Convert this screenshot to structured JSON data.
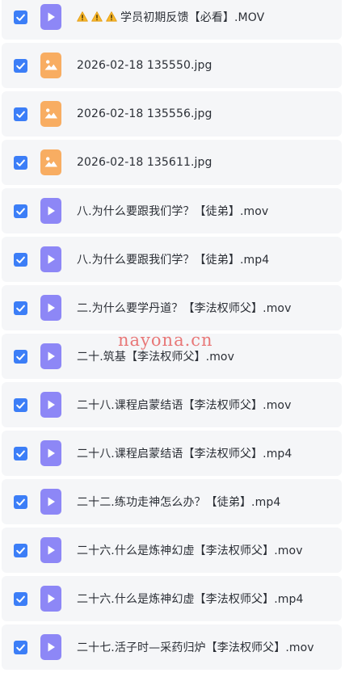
{
  "files": [
    {
      "name": "学员初期反馈【必看】.MOV",
      "type": "video",
      "checked": true,
      "prefix_icons": [
        "warning-icon",
        "warning-icon",
        "warning-icon"
      ]
    },
    {
      "name": "2026-02-18 135550.jpg",
      "type": "image",
      "checked": true
    },
    {
      "name": "2026-02-18 135556.jpg",
      "type": "image",
      "checked": true
    },
    {
      "name": "2026-02-18 135611.jpg",
      "type": "image",
      "checked": true
    },
    {
      "name": "八.为什么要跟我们学？【徒弟】.mov",
      "type": "video",
      "checked": true
    },
    {
      "name": "八.为什么要跟我们学？【徒弟】.mp4",
      "type": "video",
      "checked": true
    },
    {
      "name": "二.为什么要学丹道？【李法权师父】.mov",
      "type": "video",
      "checked": true
    },
    {
      "name": "二十.筑基【李法权师父】.mov",
      "type": "video",
      "checked": true
    },
    {
      "name": "二十八.课程启蒙结语【李法权师父】.mov",
      "type": "video",
      "checked": true
    },
    {
      "name": "二十八.课程启蒙结语【李法权师父】.mp4",
      "type": "video",
      "checked": true
    },
    {
      "name": "二十二.练功走神怎么办？【徒弟】.mp4",
      "type": "video",
      "checked": true
    },
    {
      "name": "二十六.什么是炼神幻虚【李法权师父】.mov",
      "type": "video",
      "checked": true
    },
    {
      "name": "二十六.什么是炼神幻虚【李法权师父】.mp4",
      "type": "video",
      "checked": true
    },
    {
      "name": "二十七.活子时—采药归炉【李法权师父】.mov",
      "type": "video",
      "checked": true
    }
  ],
  "watermark": "nayona.cn",
  "colors": {
    "checkbox": "#3c7ef7",
    "video_icon": "#8d87f6",
    "image_icon": "#f8ad62",
    "row_bg": "#f5f6f8",
    "text": "#2b2f36",
    "watermark": "#e76a6a"
  },
  "icons": {
    "video": "play-icon",
    "image": "image-icon",
    "checkbox": "checkmark-icon",
    "warning": "warning-icon"
  }
}
